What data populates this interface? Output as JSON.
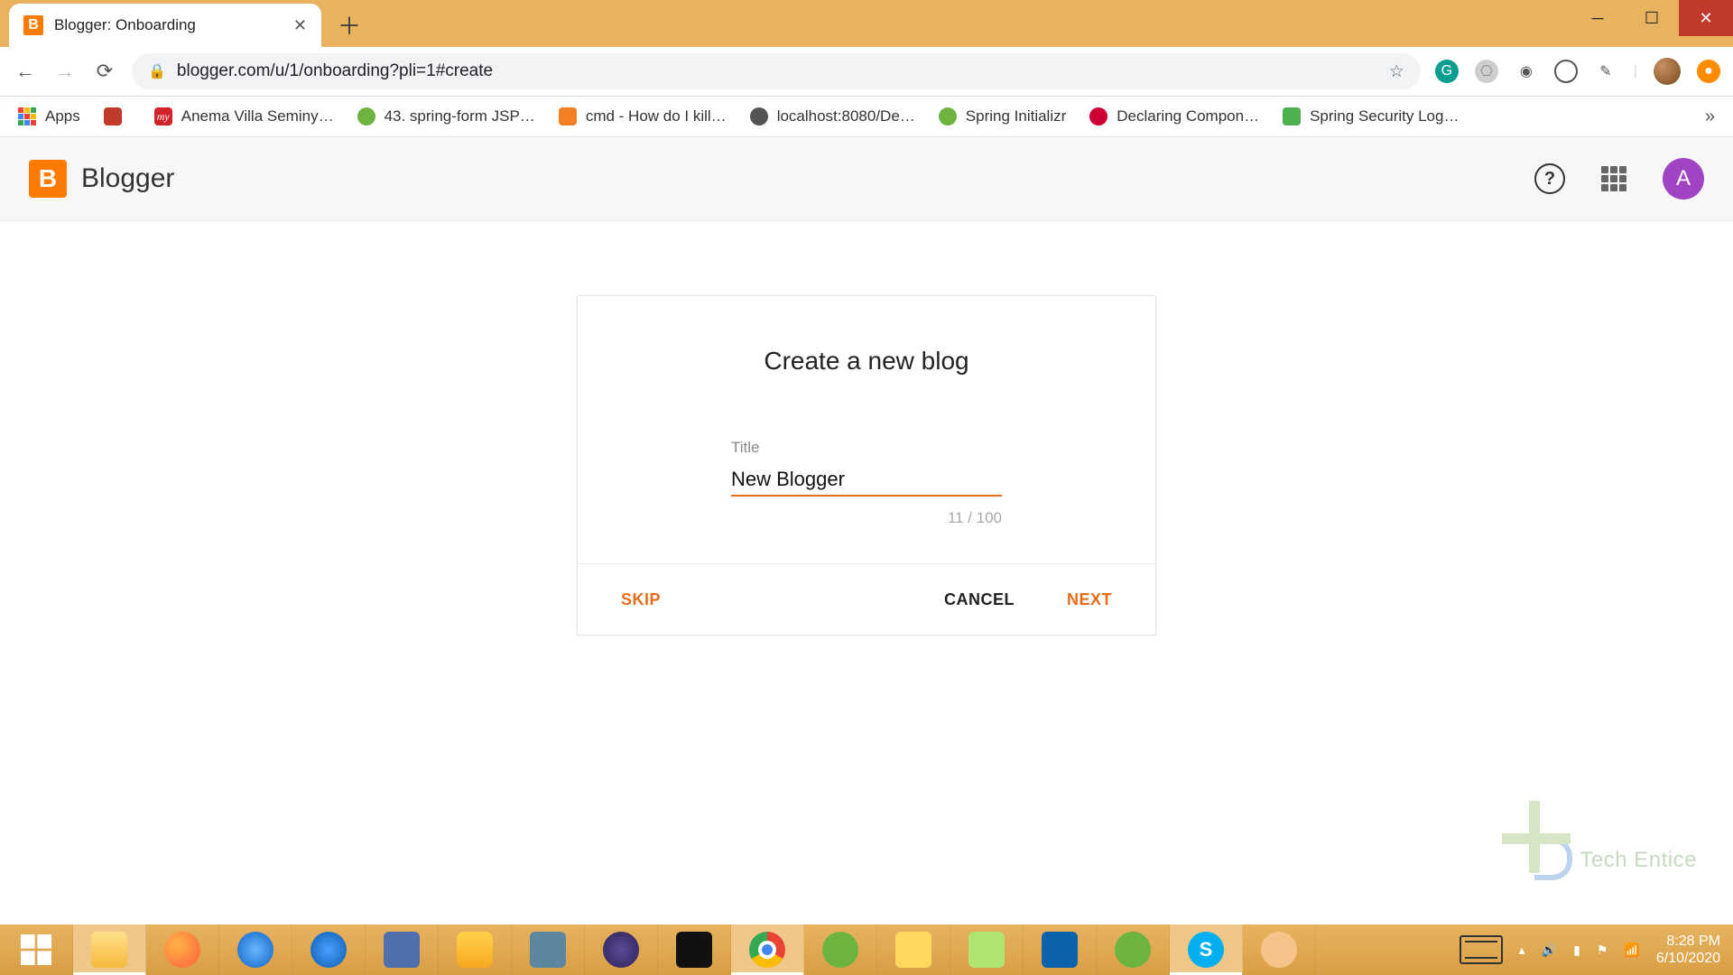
{
  "window": {
    "tab_title": "Blogger: Onboarding",
    "url": "blogger.com/u/1/onboarding?pli=1#create"
  },
  "bookmarks": {
    "apps": "Apps",
    "items": [
      {
        "label": "",
        "color": "#c03a2b"
      },
      {
        "label": "Anema Villa Seminy…",
        "color": "#d2232a"
      },
      {
        "label": "43. spring-form JSP…",
        "color": "#6db33f"
      },
      {
        "label": "cmd - How do I kill…",
        "color": "#f48024"
      },
      {
        "label": "localhost:8080/De…",
        "color": "#555"
      },
      {
        "label": "Spring Initializr",
        "color": "#6db33f"
      },
      {
        "label": "Declaring Compon…",
        "color": "#cc0033"
      },
      {
        "label": "Spring Security Log…",
        "color": "#4caf50"
      }
    ],
    "more": "»"
  },
  "app_header": {
    "brand": "Blogger",
    "avatar_initial": "A"
  },
  "modal": {
    "heading": "Create a new blog",
    "title_label": "Title",
    "title_value": "New Blogger",
    "counter": "11 / 100",
    "skip": "SKIP",
    "cancel": "CANCEL",
    "next": "NEXT"
  },
  "watermark": "Tech Entice",
  "tray": {
    "time": "8:28 PM",
    "date": "6/10/2020"
  },
  "taskbar_icons": [
    {
      "name": "windows-start",
      "color": "#ffffff"
    },
    {
      "name": "file-explorer",
      "color": "#ffd56b"
    },
    {
      "name": "firefox",
      "color": "#ff7139"
    },
    {
      "name": "internet-explorer",
      "color": "#1e88e5"
    },
    {
      "name": "thunderbird",
      "color": "#0a5cab"
    },
    {
      "name": "on-screen-keyboard",
      "color": "#4f6fae"
    },
    {
      "name": "xampp",
      "color": "#f6a821"
    },
    {
      "name": "mysql",
      "color": "#5d87a1"
    },
    {
      "name": "eclipse",
      "color": "#2c2255"
    },
    {
      "name": "cmd",
      "color": "#111"
    },
    {
      "name": "chrome",
      "color": "#fff"
    },
    {
      "name": "spring",
      "color": "#6db33f"
    },
    {
      "name": "sticky-notes",
      "color": "#ffd75e"
    },
    {
      "name": "notepadpp",
      "color": "#aee571"
    },
    {
      "name": "vscode",
      "color": "#0d62ac"
    },
    {
      "name": "spring-tool",
      "color": "#6db33f"
    },
    {
      "name": "skype",
      "color": "#00aff0"
    },
    {
      "name": "mspaint",
      "color": "#f6c38b"
    }
  ]
}
